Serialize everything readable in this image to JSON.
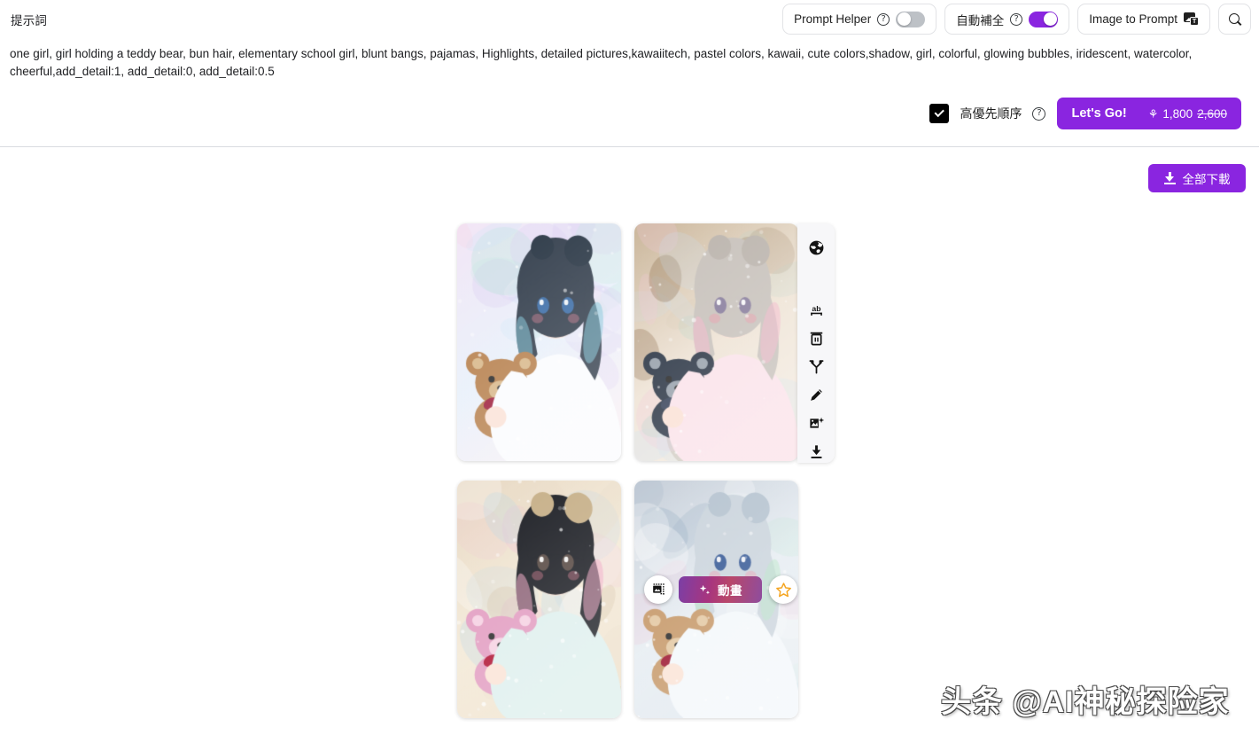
{
  "header": {
    "prompt_label": "提示詞",
    "controls": {
      "prompt_helper": {
        "label": "Prompt Helper",
        "help": "?",
        "enabled": false
      },
      "auto_complete": {
        "label": "自動補全",
        "help": "?",
        "enabled": true
      },
      "image_to_prompt": {
        "label": "Image to Prompt",
        "icon": "image-to-text-icon",
        "badge": "T"
      },
      "search": {
        "icon": "search-icon"
      }
    }
  },
  "prompt": {
    "text": "one girl, girl holding a teddy bear, bun hair, elementary school girl, blunt bangs, pajamas, Highlights, detailed pictures,kawaiitech, pastel colors, kawaii, cute colors,shadow, girl, colorful, glowing bubbles, iridescent, watercolor, cheerful,add_detail:1, add_detail:0, add_detail:0.5"
  },
  "actions": {
    "high_priority": {
      "label": "高優先順序",
      "checked": true,
      "help": "?"
    },
    "lets_go": {
      "label": "Let's Go!",
      "credit_icon": "coin-icon",
      "credit_cost": "1,800",
      "credit_original": "2,600"
    }
  },
  "toolbar": {
    "download_all": {
      "label": "全部下載",
      "icon": "download-icon"
    }
  },
  "gallery": {
    "images": [
      {
        "name": "result-image-1",
        "alt": "anime girl with dark blue bun hair holding brown teddy bear"
      },
      {
        "name": "result-image-2",
        "alt": "anime girl in pink pajamas holding dark blue teddy bear"
      },
      {
        "name": "result-image-3",
        "alt": "anime girl with black bun hair holding pink teddy bear"
      },
      {
        "name": "result-image-4",
        "alt": "anime girl with silver hair holding brown teddy bear"
      }
    ],
    "selected_index": 1
  },
  "tool_panel": {
    "items": [
      {
        "name": "publish-globe-icon",
        "title": "globe"
      },
      {
        "name": "translate-ab-icon",
        "title": "ab"
      },
      {
        "name": "delete-trash-icon",
        "title": "trash"
      },
      {
        "name": "branch-variation-icon",
        "title": "branch"
      },
      {
        "name": "edit-pencil-icon",
        "title": "pencil"
      },
      {
        "name": "image-enhance-icon",
        "title": "image-plus"
      },
      {
        "name": "download-icon",
        "title": "download"
      }
    ]
  },
  "overlay": {
    "frame_button": {
      "icon": "expand-frame-icon"
    },
    "animate_button": {
      "label": "動畫",
      "icon": "sparkle-icon"
    },
    "favorite_button": {
      "icon": "star-icon",
      "color": "#f5a623"
    }
  },
  "watermark": {
    "text": "头条 @AI神秘探险家"
  },
  "colors": {
    "accent": "#8a25e0",
    "star": "#f5a623",
    "divider": "#dadce0",
    "text": "#202124"
  }
}
